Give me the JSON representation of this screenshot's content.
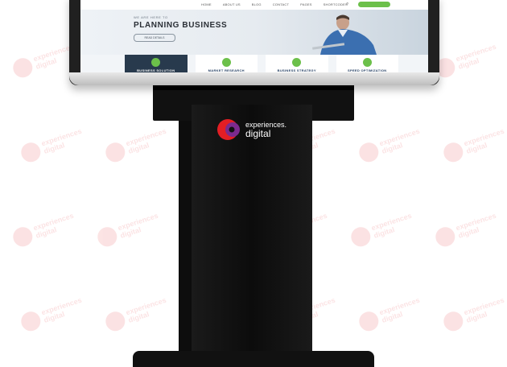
{
  "website": {
    "nav": [
      "HOME",
      "ABOUT US",
      "BLOG",
      "CONTACT",
      "PAGES",
      "SHORTCODES"
    ],
    "hero": {
      "eyebrow": "WE ARE HERE TO",
      "title": "PLANNING BUSINESS",
      "button": "READ DETAILS"
    },
    "features": [
      {
        "label": "BUSINESS SOLUTION"
      },
      {
        "label": "MARKET RESEARCH"
      },
      {
        "label": "BUSINESS STRATEGY"
      },
      {
        "label": "SPEED OPTIMIZATION"
      }
    ]
  },
  "brand": {
    "line1": "experiences.",
    "line2": "digital"
  },
  "watermark": {
    "line1": "experiences",
    "line2": "digital"
  },
  "colors": {
    "accent_green": "#6cc04a",
    "navy": "#283a4d",
    "logo_red": "#e31e24",
    "logo_purple": "#7b2a8e",
    "kiosk_black": "#111111"
  }
}
